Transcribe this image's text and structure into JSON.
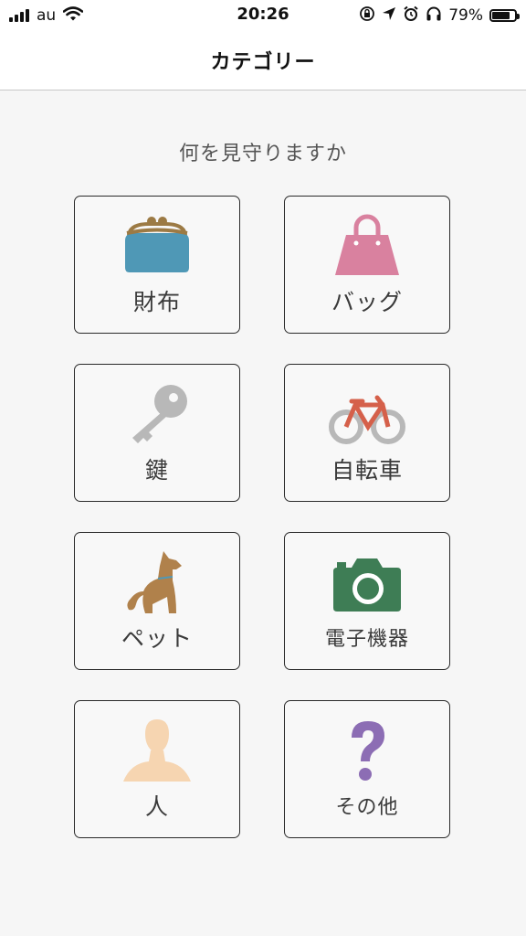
{
  "status_bar": {
    "carrier": "au",
    "time": "20:26",
    "battery_percent": "79%",
    "battery_level": 0.79
  },
  "nav": {
    "title": "カテゴリー"
  },
  "prompt": "何を見守りますか",
  "categories": [
    {
      "label": "財布",
      "icon": "purse-icon",
      "color": "#4f98b6"
    },
    {
      "label": "バッグ",
      "icon": "bag-icon",
      "color": "#d9819f"
    },
    {
      "label": "鍵",
      "icon": "key-icon",
      "color": "#b8b8b8"
    },
    {
      "label": "自転車",
      "icon": "bicycle-icon",
      "color": "#d5604a"
    },
    {
      "label": "ペット",
      "icon": "dog-icon",
      "color": "#b0814b"
    },
    {
      "label": "電子機器",
      "icon": "camera-icon",
      "color": "#3e7d55"
    },
    {
      "label": "人",
      "icon": "person-icon",
      "color": "#f6d5b1"
    },
    {
      "label": "その他",
      "icon": "question-icon",
      "color": "#8c6db4"
    }
  ]
}
